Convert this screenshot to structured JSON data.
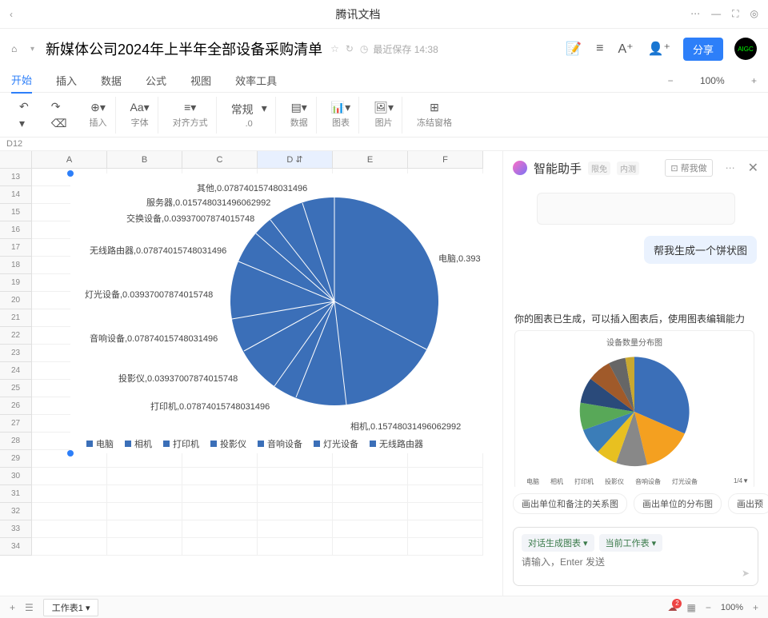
{
  "titlebar": {
    "title": "腾讯文档"
  },
  "doc": {
    "name": "新媒体公司2024年上半年全部设备采购清单",
    "save_prefix": "最近保存",
    "save_time": "14:38",
    "share": "分享",
    "avatar": "AIGC"
  },
  "tabs": {
    "items": [
      "开始",
      "插入",
      "数据",
      "公式",
      "视图",
      "效率工具"
    ],
    "active": 0,
    "zoom": "100%"
  },
  "toolbar": {
    "insert": "插入",
    "font": "字体",
    "align": "对齐方式",
    "number": "常规",
    "decimal": ".0",
    "data": "数据",
    "chart": "图表",
    "image": "图片",
    "freeze": "冻结窗格"
  },
  "cellref": "D12",
  "cols": [
    "A",
    "B",
    "C",
    "D",
    "E",
    "F"
  ],
  "rows": [
    "13",
    "14",
    "15",
    "16",
    "17",
    "18",
    "19",
    "20",
    "21",
    "22",
    "23",
    "24",
    "25",
    "26",
    "27",
    "28",
    "29",
    "30",
    "31",
    "32",
    "33",
    "34"
  ],
  "chart_data": {
    "type": "pie",
    "title": "",
    "series": [
      {
        "name": "电脑",
        "value": 0.393
      },
      {
        "name": "相机",
        "value": 0.15748031496062992
      },
      {
        "name": "打印机",
        "value": 0.07874015748031496
      },
      {
        "name": "投影仪",
        "value": 0.03937007874015748
      },
      {
        "name": "音响设备",
        "value": 0.07874015748031496
      },
      {
        "name": "灯光设备",
        "value": 0.03937007874015748
      },
      {
        "name": "无线路由器",
        "value": 0.07874015748031496
      },
      {
        "name": "交换设备",
        "value": 0.03937007874015748
      },
      {
        "name": "服务器",
        "value": 0.015748031496062992
      },
      {
        "name": "其他",
        "value": 0.07874015748031496
      }
    ],
    "labels": {
      "l0": "电脑,0.393",
      "l1": "相机,0.15748031496062992",
      "l2": "打印机,0.07874015748031496",
      "l3": "投影仪,0.03937007874015748",
      "l4": "音响设备,0.07874015748031496",
      "l5": "灯光设备,0.03937007874015748",
      "l6": "无线路由器,0.07874015748031496",
      "l7": "交换设备,0.03937007874015748",
      "l8": "服务器,0.015748031496062992",
      "l9": "其他,0.07874015748031496"
    },
    "legend": [
      "电脑",
      "相机",
      "打印机",
      "投影仪",
      "音响设备",
      "灯光设备",
      "无线路由器"
    ]
  },
  "ai": {
    "title": "智能助手",
    "badge1": "限免",
    "badge2": "内测",
    "help": "帮我做",
    "user_msg": "帮我生成一个饼状图",
    "response": "你的图表已生成，可以插入图表后，使用图表编辑能力",
    "mini_title": "设备数量分布图",
    "mini_legend": [
      "电脑",
      "相机",
      "打印机",
      "投影仪",
      "音响设备",
      "灯光设备"
    ],
    "suggestions": [
      "画出单位和备注的关系图",
      "画出单位的分布图",
      "画出预"
    ],
    "tag1": "对话生成图表",
    "tag2": "当前工作表",
    "placeholder": "请输入，Enter 发送"
  },
  "status": {
    "sheet": "工作表1",
    "zoom": "100%"
  }
}
